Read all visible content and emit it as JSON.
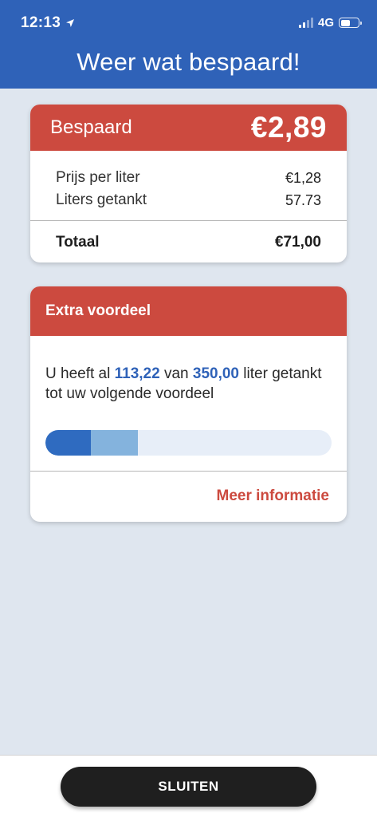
{
  "status_bar": {
    "time": "12:13",
    "network": "4G",
    "signal_bars_active": 2,
    "signal_bars_total": 4,
    "battery_level": 0.55
  },
  "header": {
    "title": "Weer wat bespaard!",
    "background_color": "#2f62b8"
  },
  "savings_card": {
    "label": "Bespaard",
    "amount": "€2,89",
    "rows": [
      {
        "label": "Prijs per liter",
        "value": "€1,28"
      },
      {
        "label": "Liters getankt",
        "value": "57.73"
      }
    ],
    "total_label": "Totaal",
    "total_value": "€71,00",
    "accent_color": "#cc4a3f"
  },
  "extra_card": {
    "title": "Extra voordeel",
    "text_prefix": "U heeft al",
    "current_liters": "113,22",
    "text_middle": "van",
    "goal_liters": "350,00",
    "text_suffix": "liter getankt tot uw volgende voordeel",
    "progress_previous": 0.16,
    "progress_current": 0.3235,
    "link_label": "Meer informatie"
  },
  "icons": {
    "location": "location-arrow-icon",
    "signal": "cellular-signal-icon",
    "battery": "battery-icon"
  },
  "footer": {
    "close_label": "SLUITEN"
  }
}
